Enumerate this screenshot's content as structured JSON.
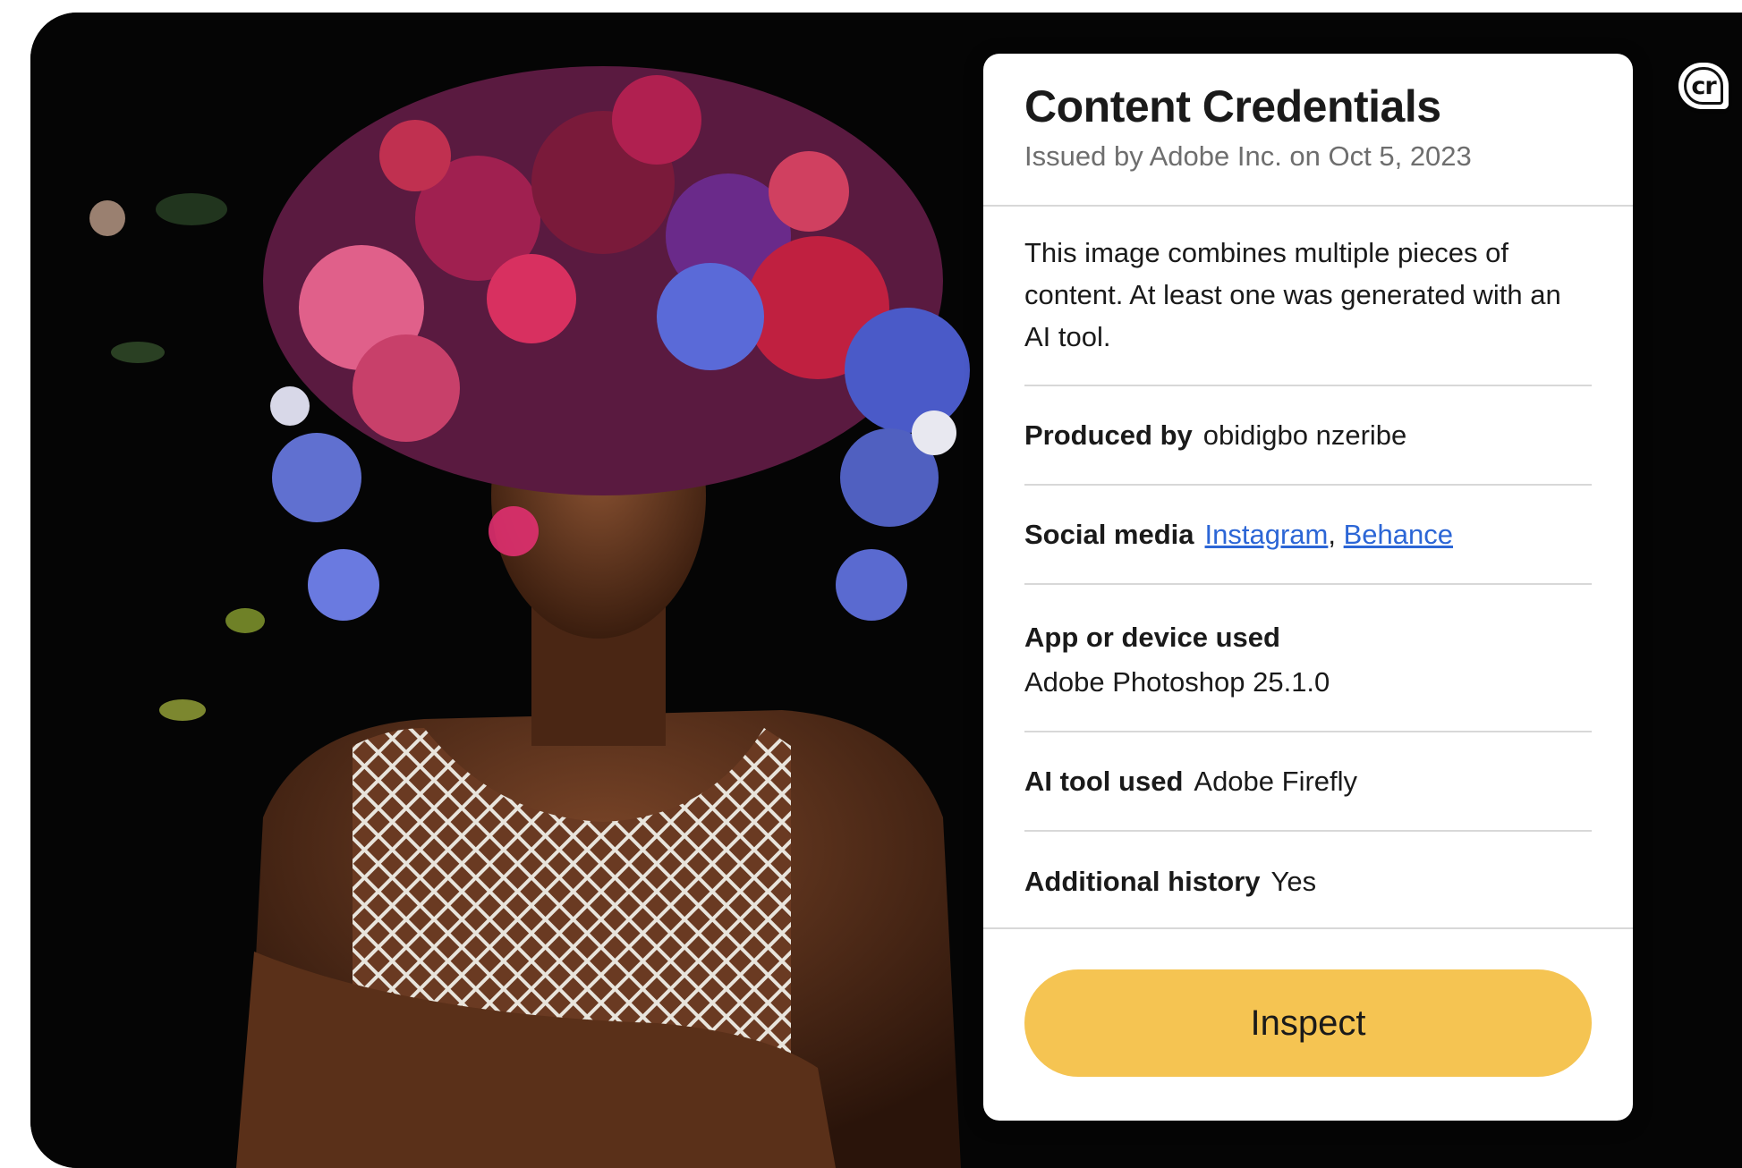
{
  "badge": {
    "label": "cr"
  },
  "panel": {
    "title": "Content Credentials",
    "subtitle": "Issued by Adobe Inc. on Oct 5, 2023",
    "description": "This image combines multiple pieces of content. At least one was generated with an AI tool.",
    "produced_by": {
      "label": "Produced by",
      "value": "obidigbo nzeribe"
    },
    "social_media": {
      "label": "Social media",
      "links": [
        "Instagram",
        "Behance"
      ],
      "separator": ","
    },
    "app_device": {
      "label": "App or device used",
      "value": "Adobe Photoshop 25.1.0"
    },
    "ai_tool": {
      "label": "AI tool used",
      "value": "Adobe Firefly"
    },
    "additional_history": {
      "label": "Additional history",
      "value": "Yes"
    },
    "inspect_label": "Inspect"
  },
  "colors": {
    "button": "#f5c452",
    "link": "#2c66d6",
    "background": "#060606"
  }
}
